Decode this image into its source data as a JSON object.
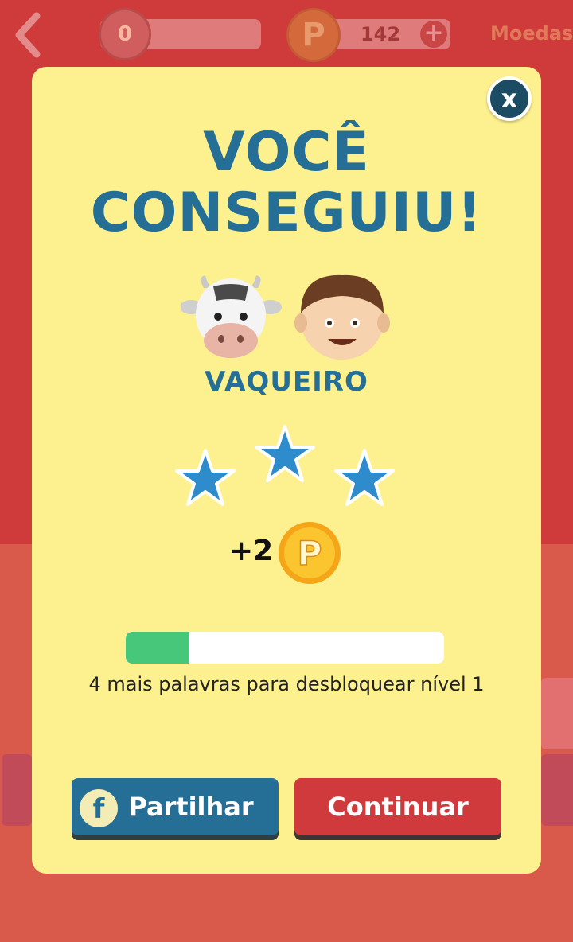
{
  "topbar": {
    "level_value": "0",
    "coins_value": "142",
    "coins_label": "Moedas",
    "coin_letter": "P",
    "plus_symbol": "+"
  },
  "modal": {
    "close_label": "x",
    "title_line1": "Você",
    "title_line2": "Conseguiu!",
    "emojis": [
      "cow-face-emoji",
      "boy-face-emoji"
    ],
    "answer": "VAQUEIRO",
    "stars_earned": 3,
    "stars_total": 3,
    "reward_text": "+2",
    "reward_coin_letter": "P",
    "progress_fraction": 0.2,
    "progress_text": "4 mais palavras para desbloquear nível 1",
    "share_icon": "f",
    "share_label": "Partilhar",
    "continue_label": "Continuar"
  },
  "colors": {
    "accent_blue": "#256f96",
    "modal_bg": "#fdf08f",
    "continue_red": "#d13a3c",
    "progress_green": "#46c77a",
    "star_blue": "#2e8ccc"
  }
}
